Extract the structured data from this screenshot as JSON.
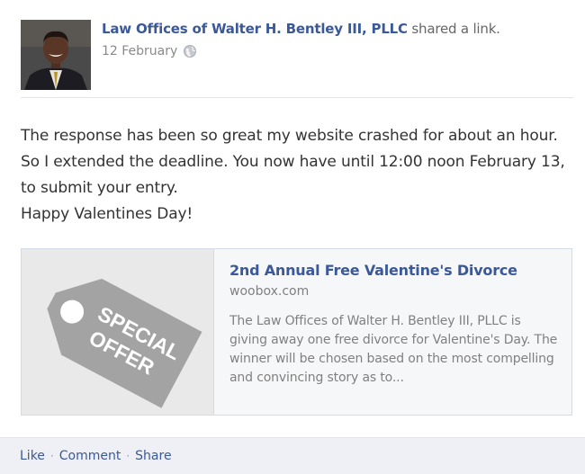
{
  "post": {
    "author_name": "Law Offices of Walter H. Bentley III, PLLC",
    "author_action": "shared a link.",
    "date": "12 February",
    "privacy_icon": "globe-icon",
    "message_lines": [
      "The response has been so great my website crashed for about an hour. So I extended the deadline. You now have until 12:00 noon February 13, to submit your entry.",
      "Happy Valentines Day!"
    ]
  },
  "attachment": {
    "image_text_line1": "SPECIAL",
    "image_text_line2": "OFFER",
    "title": "2nd Annual Free Valentine's Divorce",
    "domain": "woobox.com",
    "description": "The Law Offices of Walter H. Bentley III, PLLC is giving away one free divorce for Valentine's Day. The winner will be chosen based on the most compelling and convincing story as to..."
  },
  "actions": {
    "like": "Like",
    "comment": "Comment",
    "share": "Share",
    "separator": "·"
  },
  "colors": {
    "link": "#3b5998",
    "text": "#333333",
    "muted": "#808080",
    "footer_bg": "#eef0f5",
    "tag": "#a3a3a3"
  }
}
